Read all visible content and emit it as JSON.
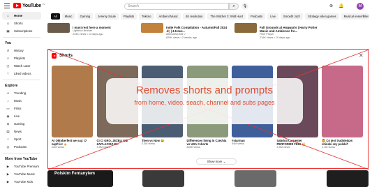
{
  "header": {
    "logo_text": "YouTube",
    "logo_suffix": "PL",
    "search_placeholder": "Search",
    "avatar_letter": "M"
  },
  "sidebar": {
    "main": [
      {
        "label": "Home",
        "icon": "⌂",
        "active": true
      },
      {
        "label": "Shorts",
        "icon": "◇"
      },
      {
        "label": "Subscriptions",
        "icon": "▣"
      }
    ],
    "you_heading": "You",
    "you": [
      {
        "label": "History",
        "icon": "↺"
      },
      {
        "label": "Playlists",
        "icon": "≡"
      },
      {
        "label": "Watch Later",
        "icon": "◷"
      },
      {
        "label": "Liked videos",
        "icon": "♡"
      }
    ],
    "explore_heading": "Explore",
    "explore": [
      {
        "label": "Trending",
        "icon": "✦"
      },
      {
        "label": "Music",
        "icon": "♪"
      },
      {
        "label": "Films",
        "icon": "▭"
      },
      {
        "label": "Live",
        "icon": "◉"
      },
      {
        "label": "Gaming",
        "icon": "◈"
      },
      {
        "label": "News",
        "icon": "▤"
      },
      {
        "label": "Sport",
        "icon": "✧"
      },
      {
        "label": "Podcasts",
        "icon": "◎"
      }
    ],
    "more_heading": "More from YouTube",
    "more": [
      {
        "label": "YouTube Premium",
        "icon": "▶"
      },
      {
        "label": "YouTube Music",
        "icon": "▶"
      },
      {
        "label": "YouTube Kids",
        "icon": "▶"
      }
    ]
  },
  "chips": [
    "All",
    "Music",
    "Gaming",
    "Jeremy Soule",
    "Playlists",
    "Tekkno",
    "Ambient Music",
    "4K resolution",
    "The Witcher 3: Wild Hunt",
    "Podcasts",
    "Live",
    "Smooth Jazz",
    "Strategy video games",
    "Musical ensembles"
  ],
  "top_videos": [
    {
      "title": "I must rest here a moment",
      "channel": "Lightfoot Brother",
      "meta": "244K views • 13 days ago"
    },
    {
      "title": "Indie Folk Compilation - Autumn/Fall 2024 🍂 | 4-Hour...",
      "channel": "alternative/folk ✓",
      "meta": "829K views • 2 weeks ago"
    },
    {
      "title": "Fall Grounds at Hogwarts | Harry Potter Music and Ambience fro...",
      "channel": "Pixel Prayer",
      "meta": "216K views • 10 days ago"
    }
  ],
  "shorts": {
    "heading": "Shorts",
    "items": [
      {
        "title": "At Oktoberfest we say: O' zapft is! 🍺",
        "views": "22M views",
        "color": "#b07a4a"
      },
      {
        "title": "CI CI GRO, JEŻELI NIE ZAPLACISZ W...",
        "views": "3.9M views",
        "color": "#7d6a5a"
      },
      {
        "title": "Then vs Now 😂",
        "views": "2.3M views",
        "color": "#4a5d72"
      },
      {
        "title": "Differences living in Czechia vs USA #shorts",
        "views": "843K views",
        "color": "#8a9a7a"
      },
      {
        "title": "#starman",
        "views": "54M views",
        "color": "#3f5f9a"
      },
      {
        "title": "Sabrina Carpenter PERFORMS FEIN 🤯",
        "views": "4.9M views",
        "color": "#6a4a5a"
      },
      {
        "title": "🤷 Co jest trudniejsze: chiński czy polski?",
        "views": "1.1M views",
        "color": "#c76a8a"
      }
    ],
    "show_more": "Show more"
  },
  "overlay": {
    "main": "Removes shorts and prompts",
    "sub": "from home, video, seach, channel and subs pages"
  },
  "bottom": {
    "caption": "Polskim Fentanylem"
  },
  "colors": {
    "accent": "#ff0000",
    "overlay_text": "#e04a2f",
    "cross": "#e33333"
  }
}
